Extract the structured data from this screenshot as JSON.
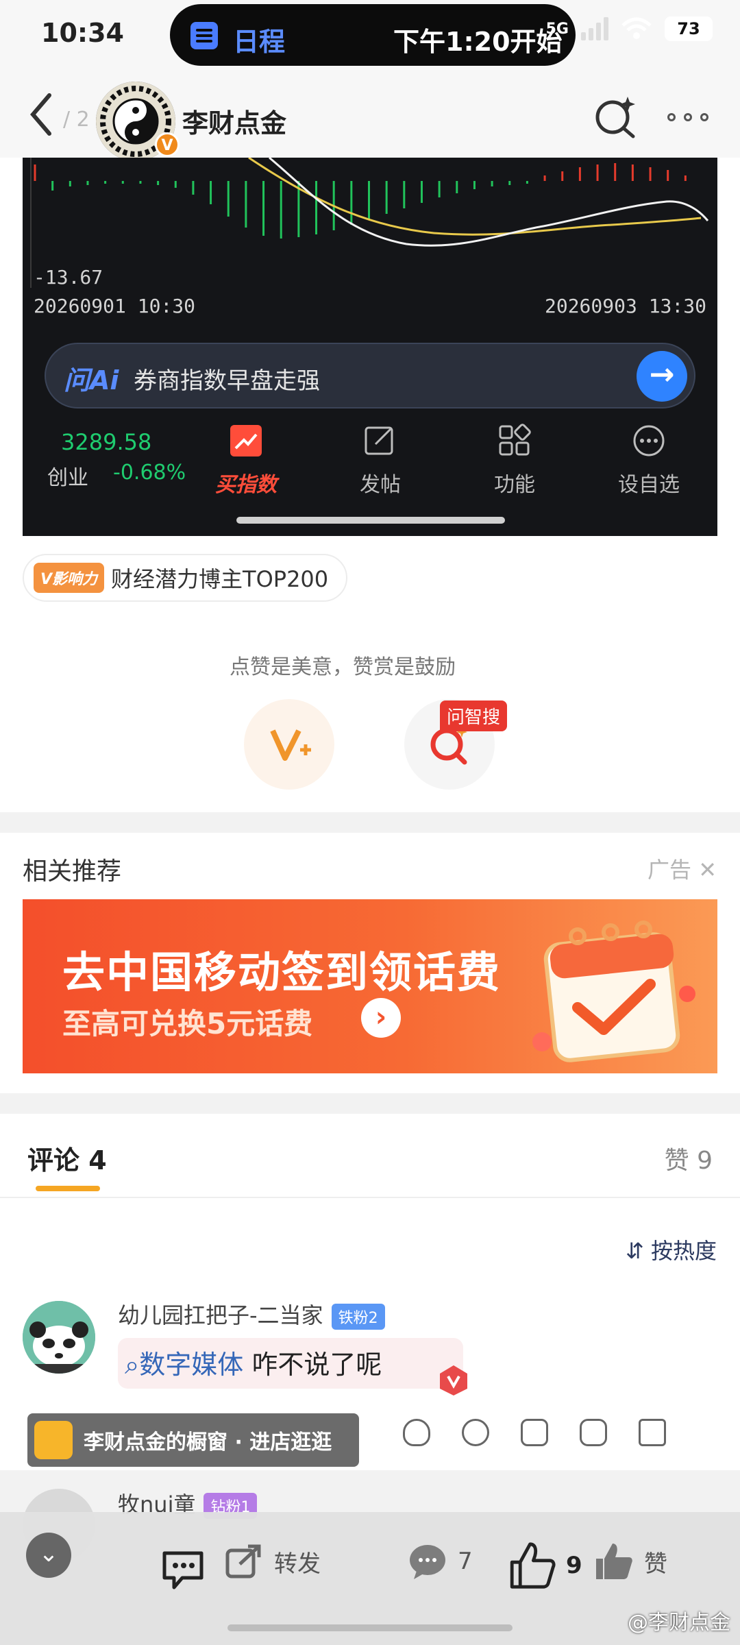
{
  "status": {
    "time": "10:34",
    "battery": "73",
    "network": "5G"
  },
  "island": {
    "app_name": "日程",
    "text": "下午1:20开始"
  },
  "nav": {
    "page_count": "/ 2",
    "account_name": "李财点金"
  },
  "stock": {
    "low_label": "-13.67",
    "start_time": "20260901 10:30",
    "end_time": "20260903 13:30",
    "ai_logo": "问Ai",
    "ai_query": "券商指数早盘走强",
    "index_value": "3289.58",
    "index_name": "创业",
    "index_change": "-0.68%",
    "tools": [
      "买指数",
      "发帖",
      "功能",
      "设自选"
    ],
    "colors": {
      "up": "#e53b2c",
      "down": "#21c35b",
      "ma_white": "#f2f2f2",
      "ma_yellow": "#e8c94b"
    }
  },
  "influence": {
    "tag": "V影响力",
    "text": "财经潜力博主TOP200"
  },
  "reward": {
    "hint": "点赞是美意，赞赏是鼓励",
    "search_tag": "问智搜"
  },
  "recommend": {
    "title": "相关推荐",
    "ad_label": "广告",
    "ad_title": "去中国移动签到领话费",
    "ad_subtitle": "至高可兑换5元话费"
  },
  "comments": {
    "tab_label": "评论 4",
    "likes_label": "赞 9",
    "sort_label": "按热度",
    "items": [
      {
        "user": "幼儿园扛把子-二当家",
        "badge": "铁粉2",
        "topic": "数字媒体",
        "text": " 咋不说了呢"
      },
      {
        "user": "牧nui童",
        "badge": "钻粉1"
      }
    ],
    "shop_text": "李财点金的橱窗 · 进店逛逛"
  },
  "actions": {
    "repost": "转发",
    "comments": "7",
    "likes": "9",
    "like_label": "赞"
  },
  "watermark": "@李财点金"
}
